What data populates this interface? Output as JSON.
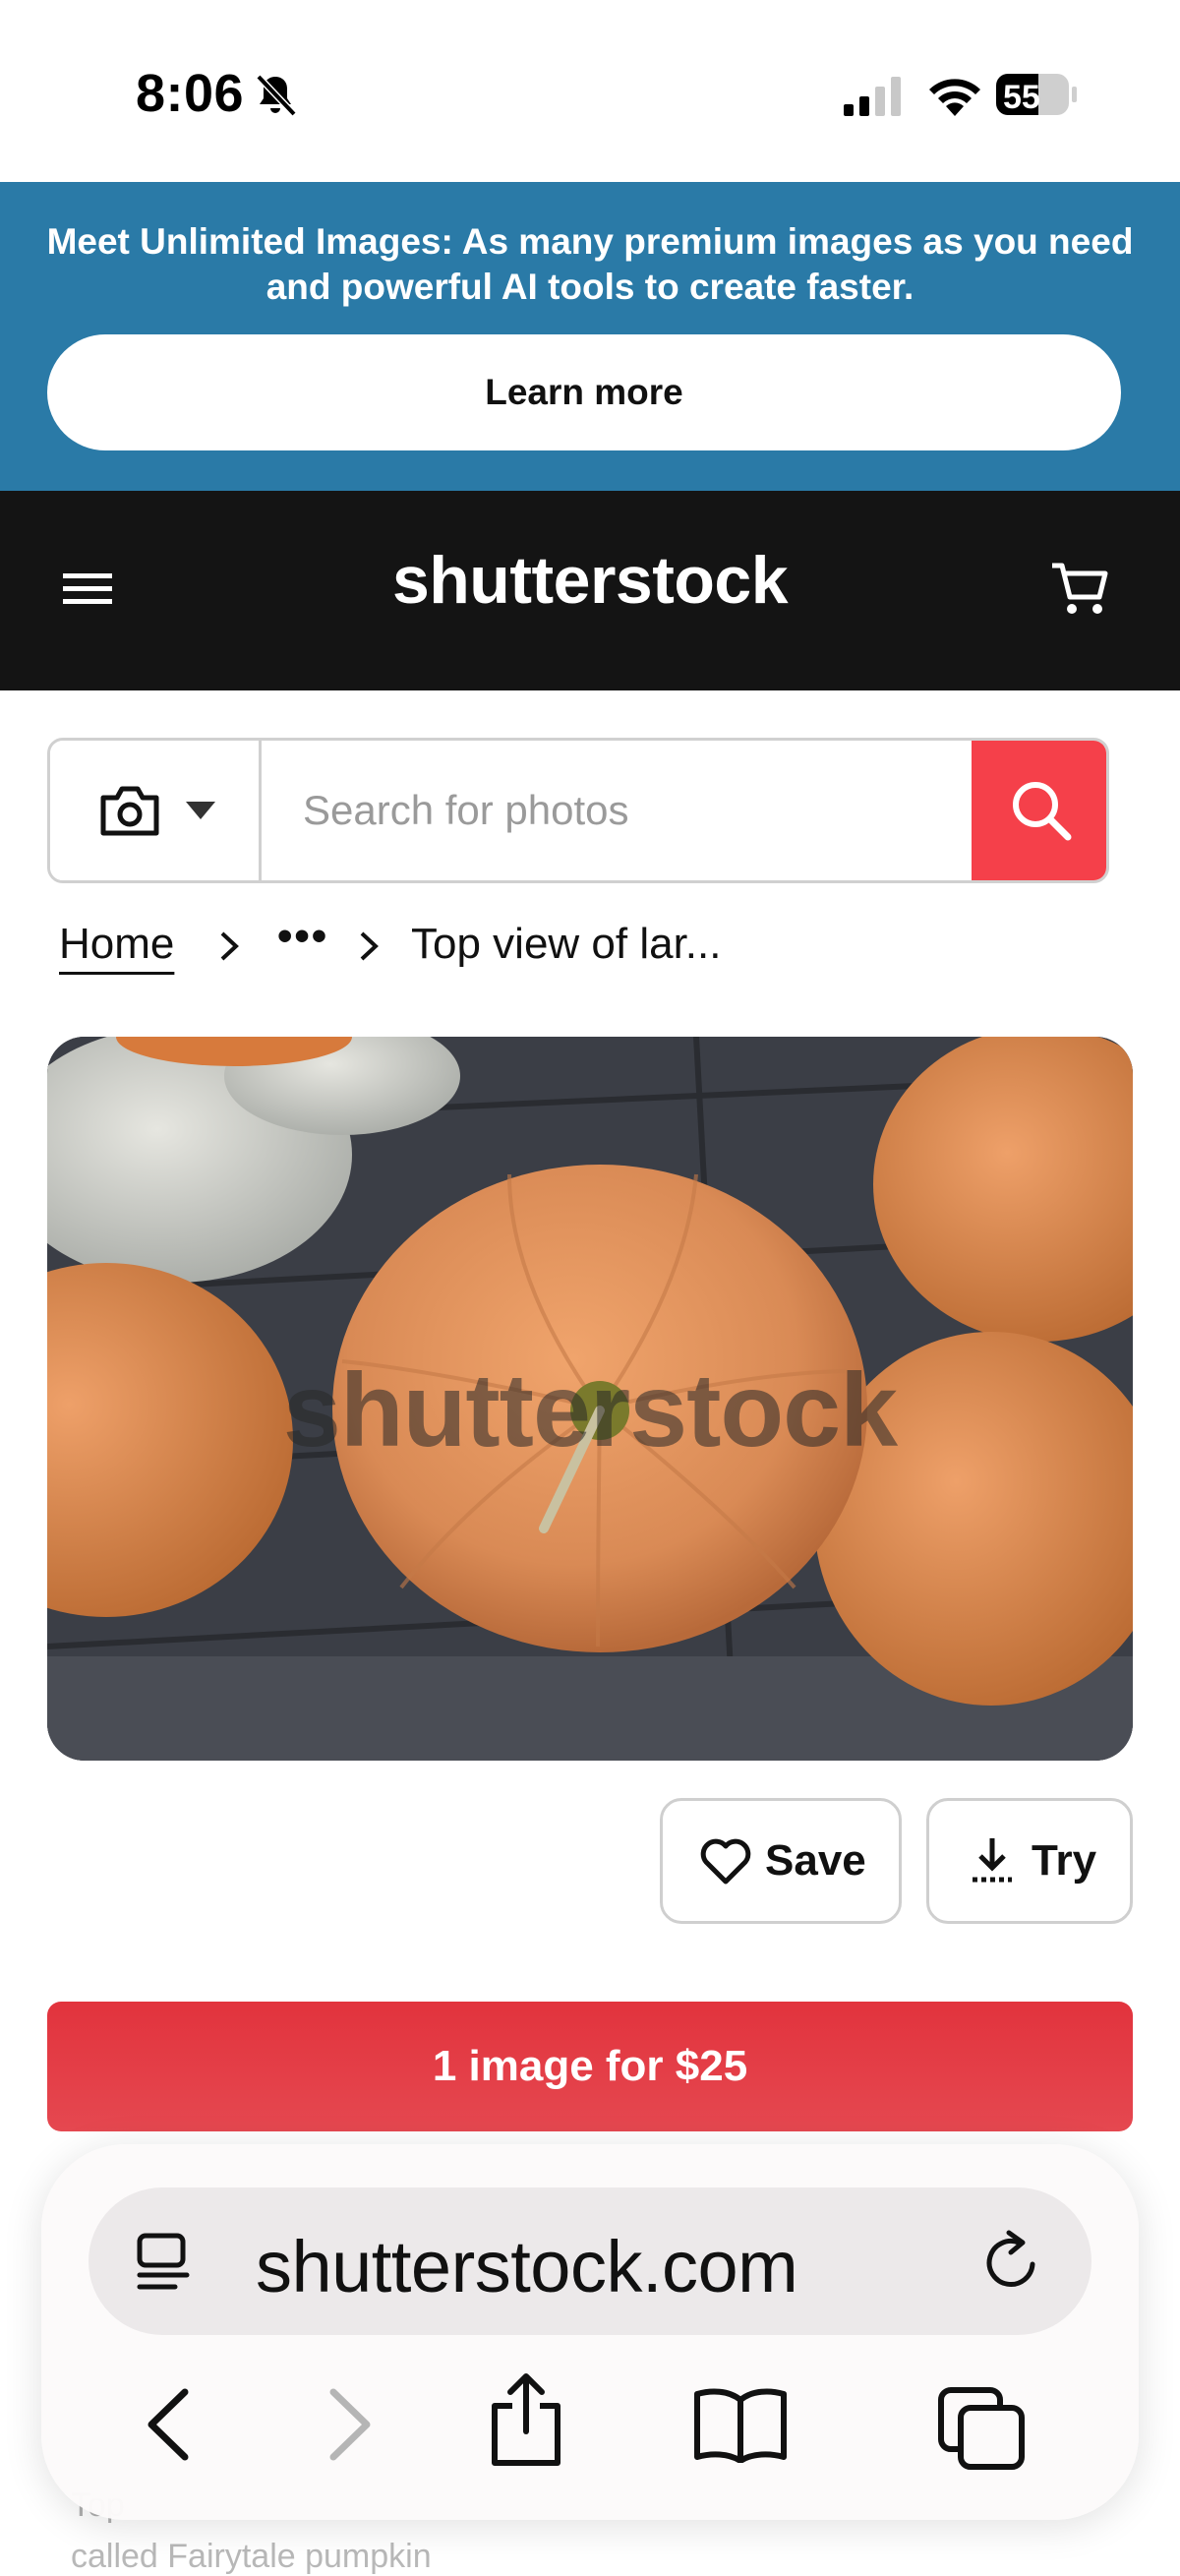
{
  "status_bar": {
    "time": "8:06",
    "battery_level": "55"
  },
  "promo": {
    "text_line1": "Meet Unlimited Images: As many premium images as you need",
    "text_line2": "and powerful AI tools to create faster.",
    "button_label": "Learn more"
  },
  "header": {
    "logo": "shutterstock"
  },
  "search": {
    "placeholder": "Search for photos"
  },
  "breadcrumb": {
    "home": "Home",
    "ellipsis": "•••",
    "current": "Top view of lar..."
  },
  "image": {
    "watermark": "shutterstock"
  },
  "actions": {
    "save_label": "Save",
    "try_label": "Try"
  },
  "price_button": {
    "label": "1 image for $25"
  },
  "below_content": {
    "line1": "Top",
    "line2": "called Fairytale pumpkin"
  },
  "browser": {
    "url": "shutterstock.com"
  },
  "colors": {
    "promo": "#2a7aa7",
    "header": "#141414",
    "accent_red": "#f5404a",
    "price_red": "#e2333d"
  }
}
